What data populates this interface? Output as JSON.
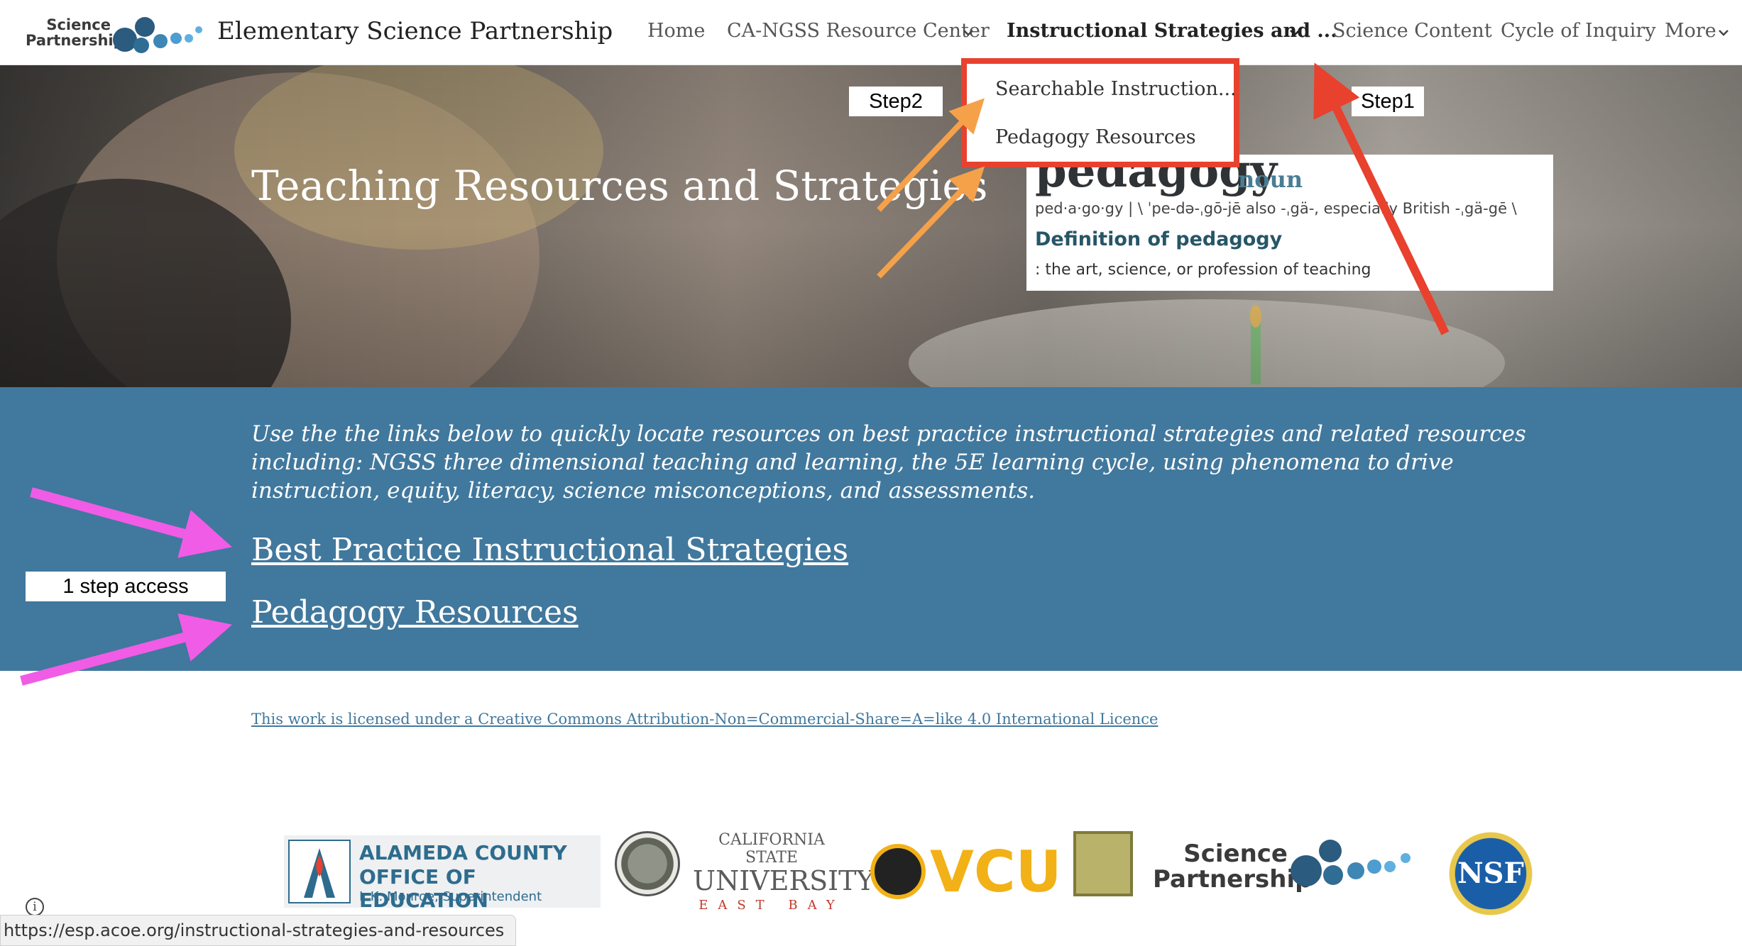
{
  "header": {
    "logo_text_line1": "Science",
    "logo_text_line2": "Partnership",
    "site_title": "Elementary Science Partnership",
    "nav": {
      "home": "Home",
      "resource_center": "CA-NGSS Resource Center",
      "instructional": "Instructional Strategies and ...",
      "science_content": "Science Content",
      "cycle_of_inquiry": "Cycle of Inquiry",
      "more": "More"
    }
  },
  "dropdown": {
    "items": [
      "Searchable Instruction...",
      "Pedagogy Resources"
    ]
  },
  "hero": {
    "title": "Teaching Resources and Strategies",
    "dictionary": {
      "word": "pedagogy",
      "part_of_speech": "noun",
      "pronunciation": "ped·a·go·gy  |  \\ ˈpe-də-ˌgō-jē  also -ˌgä-, especially British -ˌgä-gē \\",
      "definition_heading": "Definition of pedagogy",
      "definition": ": the art, science, or profession of teaching"
    }
  },
  "annotations": {
    "step1": "Step1",
    "step2": "Step2",
    "one_step": "1 step access",
    "colors": {
      "red": "#e8412e",
      "orange": "#f5a14a",
      "magenta": "#f05ce6"
    }
  },
  "band": {
    "intro": "Use the the links below to quickly locate resources on best practice instructional strategies and related resources including: NGSS three dimensional teaching and learning, the 5E learning cycle, using phenomena to drive instruction, equity, literacy, science misconceptions, and assessments.",
    "links": [
      "Best Practice Instructional Strategies",
      "Pedagogy Resources"
    ],
    "color": "#41789d"
  },
  "footer": {
    "license": "This work is licensed under a Creative Commons Attribution-Non=Commercial-Share=A=like 4.0 International Licence",
    "logos": {
      "acoe_line1": "ALAMEDA COUNTY",
      "acoe_line2": "OFFICE OF EDUCATION",
      "acoe_line3": "L.K. Monroe, Superintendent",
      "csu_line1": "CALIFORNIA STATE",
      "csu_line2": "UNIVERSITY",
      "csu_line3": "EAST BAY",
      "vcu": "VCU",
      "sp_line1": "Science",
      "sp_line2": "Partnership",
      "nsf": "NSF"
    }
  },
  "status_bar": {
    "url": "https://esp.acoe.org/instructional-strategies-and-resources",
    "info_icon": "i"
  }
}
